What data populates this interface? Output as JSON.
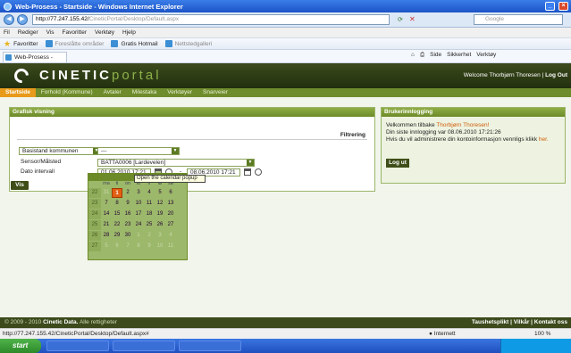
{
  "browser": {
    "title": "Web-Prosess - Startside - Windows Internet Explorer",
    "address_host": "http://77.247.155.42/",
    "address_path": "CineticPortal/Desktop/Default.aspx",
    "search_placeholder": "Google",
    "menu": [
      "Fil",
      "Rediger",
      "Vis",
      "Favoritter",
      "Verktøy",
      "Hjelp"
    ],
    "favorites_label": "Favoritter",
    "fav_items": [
      "Foreslåtte områder",
      "Gratis Hotmail",
      "Nettstedgalleri"
    ],
    "tab_title": "Web-Prosess - Startside",
    "commands": [
      "Side",
      "Sikkerhet",
      "Verktøy"
    ],
    "status_url": "http://77.247.155.42/CineticPortal/Desktop/Default.aspx#",
    "zone": "Internett",
    "zoom": "100 %"
  },
  "site": {
    "logo_main": "CINETIC",
    "logo_sub": "portal",
    "welcome": "Welcome Thorbjørn Thoresen",
    "logout_link": "Log Out",
    "nav": [
      "Startside",
      "Forhold (Kommune)",
      "Avtaler",
      "Milestaka",
      "Verktøyer",
      "Snarveier"
    ]
  },
  "left_panel": {
    "title": "Grafisk visning",
    "filter_label": "Filtrering",
    "select1": "Basistand kommunen",
    "select2": "---",
    "label_source": "Sensor/Målsted",
    "source_value": "BATTA0006 [Lardevelen]",
    "label_interval": "Dato intervall",
    "date_from": "01.06.2010 17:21",
    "date_to": "08.06.2010 17:21",
    "show_button": "Vis"
  },
  "calendar": {
    "tooltip": "Open the calendar popup",
    "dows": [
      "ma",
      "ti",
      "on",
      "to",
      "fr",
      "lø",
      "sø"
    ],
    "rows": [
      [
        "22",
        "31",
        "1",
        "2",
        "3",
        "4",
        "5",
        "6"
      ],
      [
        "23",
        "7",
        "8",
        "9",
        "10",
        "11",
        "12",
        "13"
      ],
      [
        "24",
        "14",
        "15",
        "16",
        "17",
        "18",
        "19",
        "20"
      ],
      [
        "25",
        "21",
        "22",
        "23",
        "24",
        "25",
        "26",
        "27"
      ],
      [
        "26",
        "28",
        "29",
        "30",
        "1",
        "2",
        "3",
        "4"
      ],
      [
        "27",
        "5",
        "6",
        "7",
        "8",
        "9",
        "10",
        "11"
      ]
    ],
    "selected": "1"
  },
  "right_panel": {
    "title": "Brukerinnlogging",
    "line1_prefix": "Velkommen tilbake",
    "line1_name": "Thorbjørn Thoresen!",
    "line2": "Din siste innlogging var 08.06.2010 17:21:26",
    "line3_prefix": "Hvis du vil administrere din kontoinformasjon vennligs klikk",
    "line3_link": "her.",
    "logout_button": "Log ut"
  },
  "footer": {
    "copyright": "© 2009 - 2010",
    "company": "Cinetic Data.",
    "rights": "Alle rettigheter",
    "links": "Taushetsplikt | Vilkår | Kontakt oss"
  },
  "colors": {
    "header_bg": "#22300f",
    "nav_bg": "#6f8c2c",
    "accent_orange": "#e89a1a",
    "panel_green": "#6c8a27"
  }
}
